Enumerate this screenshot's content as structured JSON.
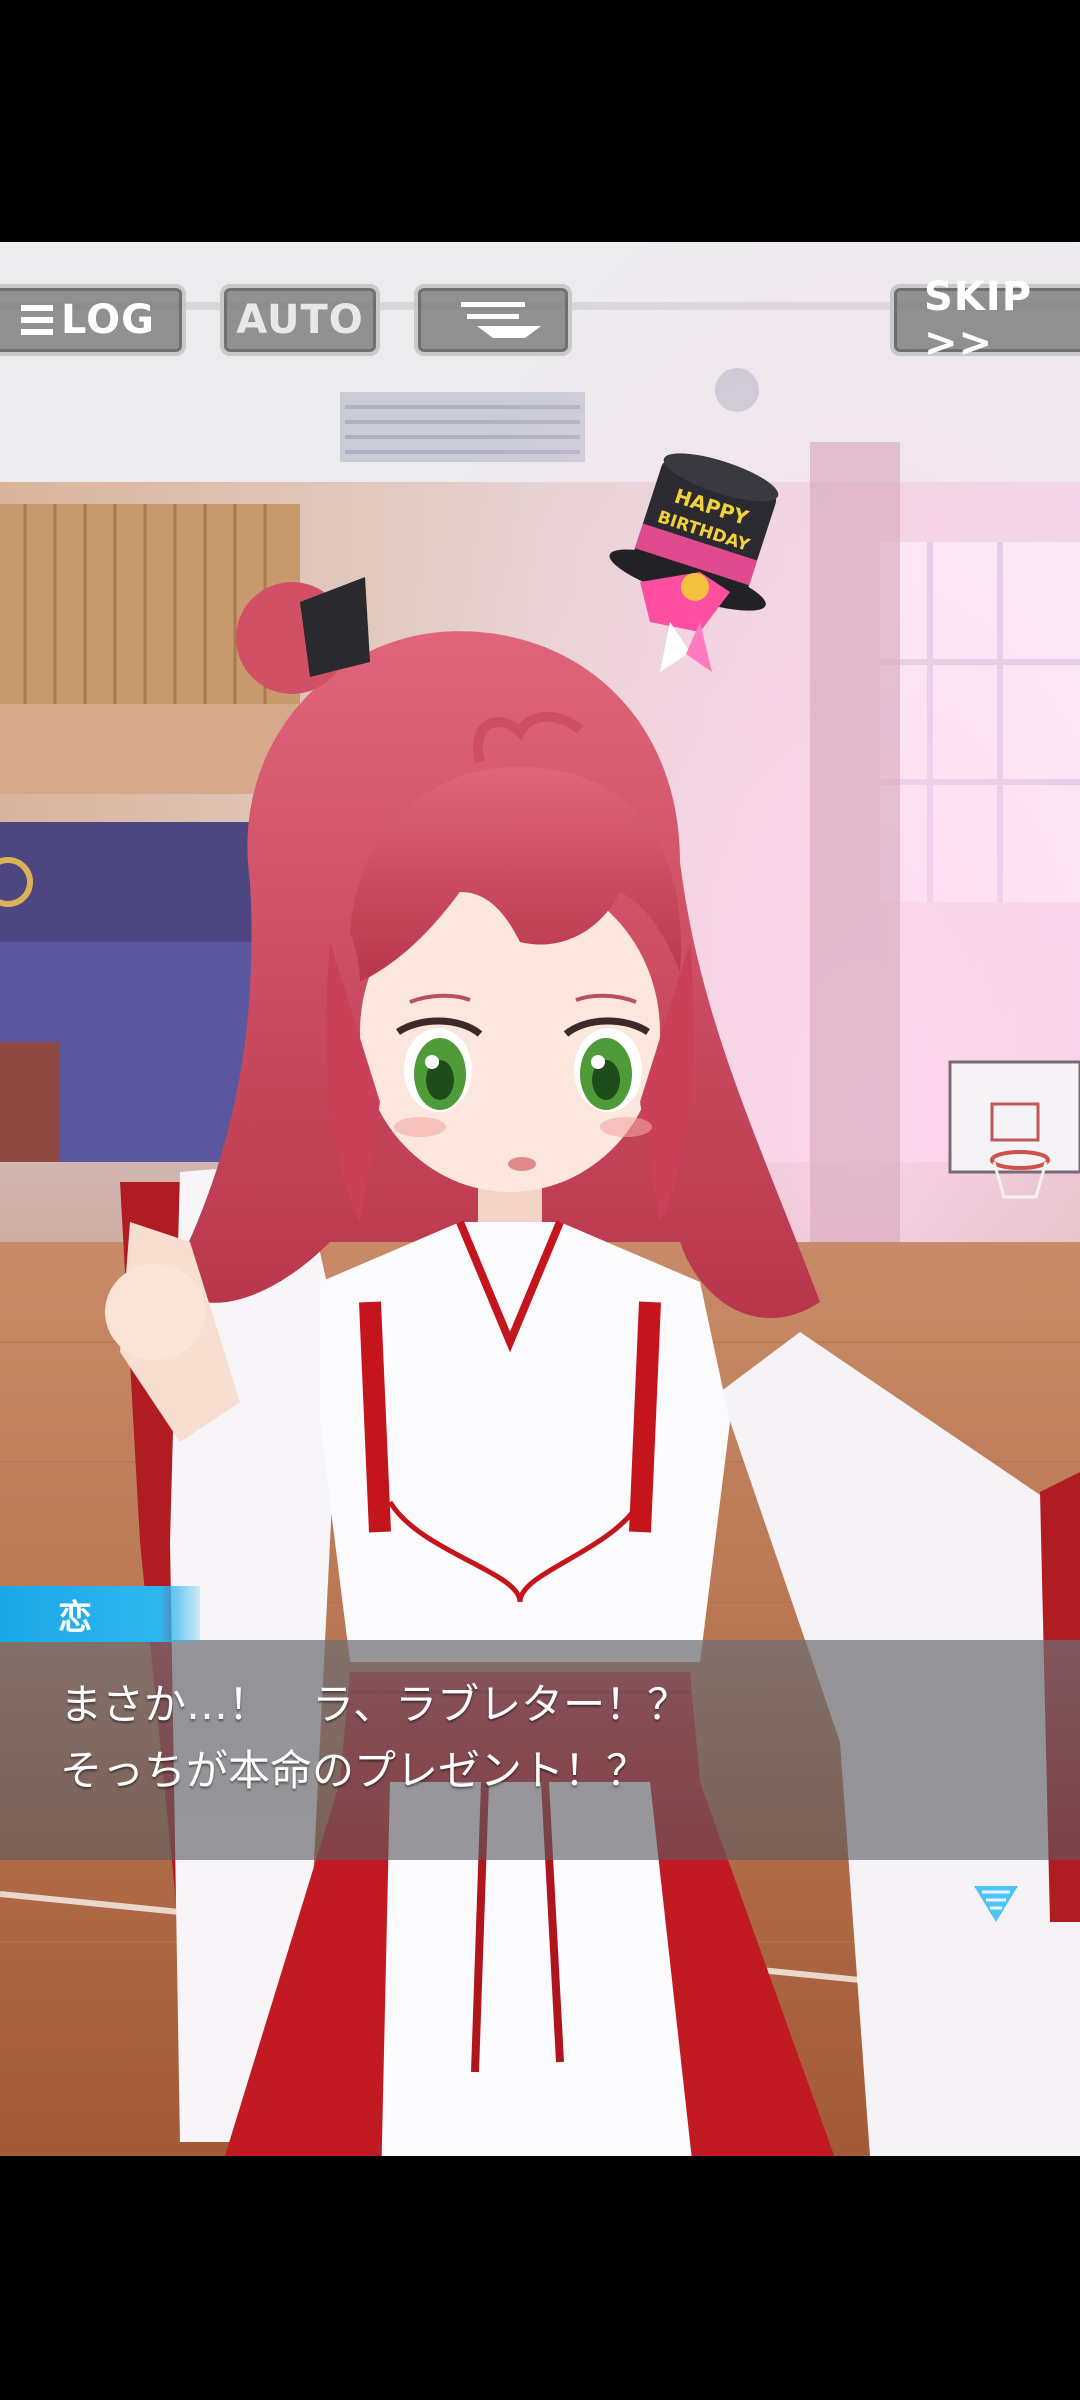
{
  "toolbar": {
    "log_label": "LOG",
    "auto_label": "AUTO",
    "skip_label": "SKIP >>"
  },
  "dialogue": {
    "speaker": "恋",
    "text": "まさか…！　ラ、ラブレター！？\nそっちが本命のプレゼント！？"
  },
  "scene": {
    "hat_text_1": "HAPPY",
    "hat_text_2": "BIRTHDAY"
  },
  "colors": {
    "speaker_tab": "#1ba7e6",
    "button_bg": "#7d7d7d",
    "hair": "#d9586a",
    "outfit_red": "#c4141c"
  },
  "icons": [
    "hamburger-icon",
    "text-speed-icon",
    "next-arrow-icon"
  ]
}
